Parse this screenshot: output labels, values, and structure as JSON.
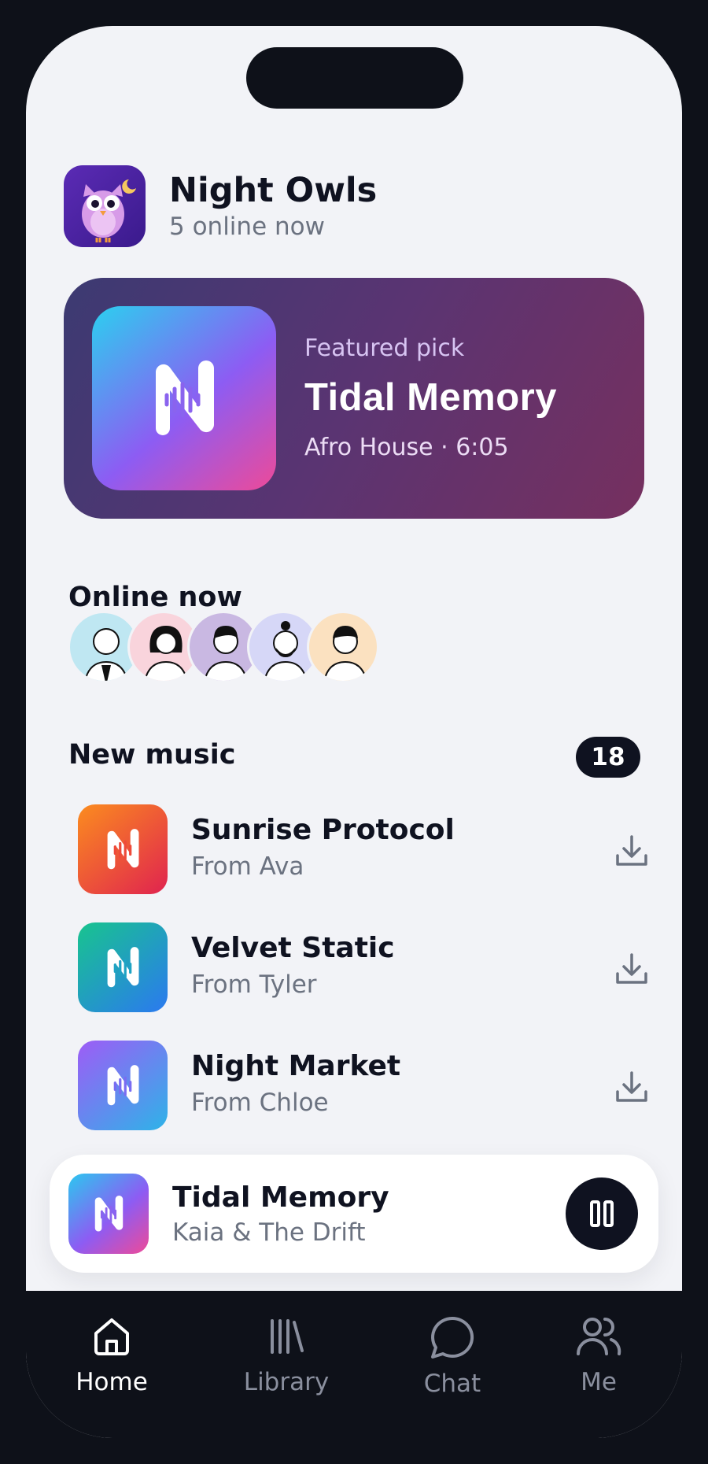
{
  "header": {
    "title": "Night Owls",
    "subtitle": "5 online now"
  },
  "featured": {
    "label": "Featured pick",
    "title": "Tidal Memory",
    "meta": "Afro House · 6:05"
  },
  "online": {
    "title": "Online now",
    "avatars": [
      {
        "bg": "#bfe7f2"
      },
      {
        "bg": "#f9d4dc"
      },
      {
        "bg": "#c9b8e2"
      },
      {
        "bg": "#d6d7f7"
      },
      {
        "bg": "#fbe1c0"
      }
    ]
  },
  "music": {
    "title": "New music",
    "count": "18",
    "tracks": [
      {
        "name": "Sunrise Protocol",
        "from": "From Ava",
        "gradient": [
          "#fb8c1f",
          "#e0234f"
        ]
      },
      {
        "name": "Velvet Static",
        "from": "From Tyler",
        "gradient": [
          "#18c48e",
          "#2b79f0"
        ]
      },
      {
        "name": "Night Market",
        "from": "From Chloe",
        "gradient": [
          "#9e5cf6",
          "#2eb3e8"
        ]
      }
    ]
  },
  "player": {
    "title": "Tidal Memory",
    "artist": "Kaia & The Drift"
  },
  "tabs": [
    {
      "label": "Home",
      "icon": "home-icon",
      "active": true
    },
    {
      "label": "Library",
      "icon": "library-icon",
      "active": false
    },
    {
      "label": "Chat",
      "icon": "chat-icon",
      "active": false
    },
    {
      "label": "Me",
      "icon": "people-icon",
      "active": false
    }
  ],
  "colors": {
    "accent_dark": "#0f1220",
    "background": "#f2f3f7",
    "muted_text": "#6b7280"
  }
}
